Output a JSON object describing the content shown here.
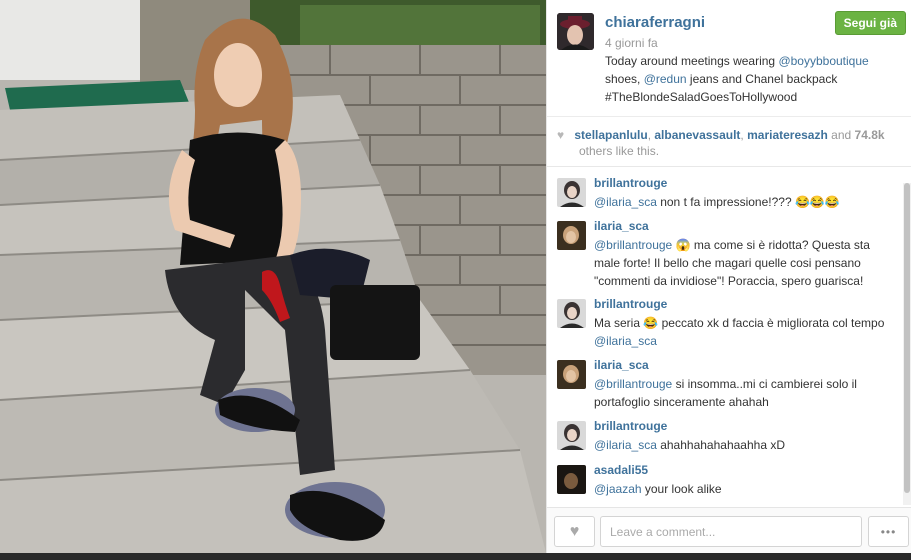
{
  "post": {
    "username": "chiaraferragni",
    "time": "4 giorni fa",
    "follow_label": "Segui già",
    "caption": {
      "p1": "Today around meetings wearing ",
      "m1": "@boyybboutique",
      "p2": " shoes, ",
      "m2": "@redun",
      "p3": " jeans and Chanel backpack",
      "hashtag": "#TheBlondeSaladGoesToHollywood"
    }
  },
  "likes": {
    "names": [
      "stellapanlulu",
      "albanevassault",
      "mariateresazh"
    ],
    "and_text": "and",
    "count": "74.8k",
    "rest": "others like this."
  },
  "comments": [
    {
      "user": "brillantrouge",
      "mention": "@ilaria_sca",
      "text": " non t fa impressione!??? 😂😂😂"
    },
    {
      "user": "ilaria_sca",
      "mention": "@brillantrouge",
      "text": " 😱 ma come si è ridotta? Questa sta male forte! Il bello che magari quelle cosi pensano \"commenti da invidiose\"! Poraccia, spero guarisca!"
    },
    {
      "user": "brillantrouge",
      "mention": "",
      "text": "Ma seria 😂 peccato xk d faccia è migliorata col tempo ",
      "mention_after": "@ilaria_sca"
    },
    {
      "user": "ilaria_sca",
      "mention": "@brillantrouge",
      "text": " si insomma..mi ci cambierei solo il portafoglio sinceramente ahahah"
    },
    {
      "user": "brillantrouge",
      "mention": "@ilaria_sca",
      "text": " ahahhahahahaahha xD"
    },
    {
      "user": "asadali55",
      "mention": "@jaazah",
      "text": " your look alike"
    }
  ],
  "input": {
    "placeholder": "Leave a comment..."
  },
  "icons": {
    "like": "heart-icon",
    "more": "ellipsis-icon"
  }
}
